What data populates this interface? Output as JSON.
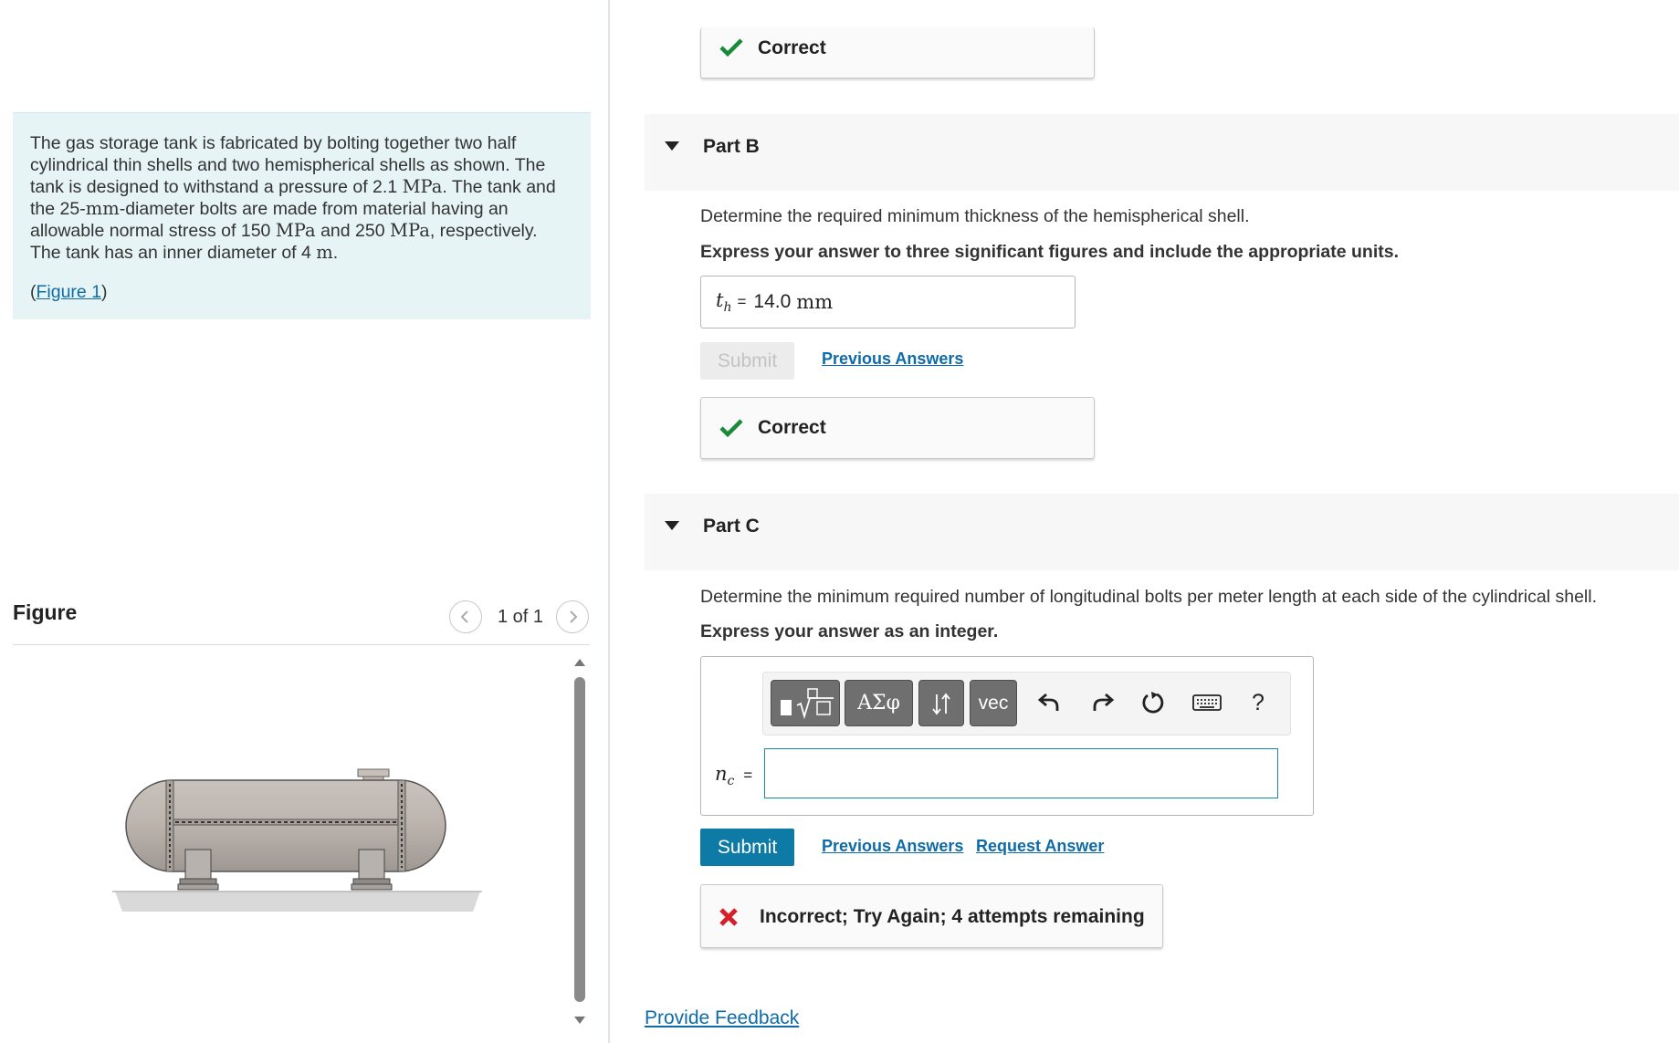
{
  "problem": {
    "line1": "The gas storage tank is fabricated by bolting together two half",
    "line2": "cylindrical thin shells and two hemispherical shells as shown. The",
    "line3_pre": "tank is designed to withstand a pressure of 2.1 ",
    "line3_unit": "MPa",
    "line3_post": ". The tank and",
    "line4_pre": "the 25-",
    "line4_unit": "mm",
    "line4_post": "-diameter bolts are made from material having an",
    "line5_pre": "allowable normal stress of 150 ",
    "line5_unit1": "MPa",
    "line5_mid": " and 250 ",
    "line5_unit2": "MPa",
    "line5_post": ", respectively.",
    "line6_pre": "The tank has an inner diameter of 4 ",
    "line6_unit": "m",
    "line6_post": ".",
    "figure_link": "Figure 1"
  },
  "figure": {
    "title": "Figure",
    "counter": "1 of 1",
    "prev_icon": "chevron-left-icon",
    "next_icon": "chevron-right-icon"
  },
  "part_a": {
    "feedback": "Correct"
  },
  "part_b": {
    "label": "Part B",
    "question": "Determine the required minimum thickness of the hemispherical shell.",
    "instruction": "Express your answer to three significant figures and include the appropriate units.",
    "var_base": "t",
    "var_sub": "h",
    "equals": "=",
    "answer_value": "14.0",
    "answer_unit": "mm",
    "submit_label": "Submit",
    "previous_answers": "Previous Answers",
    "feedback": "Correct"
  },
  "part_c": {
    "label": "Part C",
    "question": "Determine the minimum required number of longitudinal bolts per meter length at each side of the cylindrical shell.",
    "instruction": "Express your answer as an integer.",
    "var_base": "n",
    "var_sub": "c",
    "equals": "=",
    "input_value": "",
    "toolbar": {
      "greek_label": "ΑΣφ",
      "vec_label": "vec",
      "help_label": "?"
    },
    "submit_label": "Submit",
    "previous_answers": "Previous Answers",
    "request_answer": "Request Answer",
    "feedback": "Incorrect; Try Again; 4 attempts remaining"
  },
  "footer": {
    "provide_feedback": "Provide Feedback"
  },
  "colors": {
    "link": "#0e6ba8",
    "submit": "#0d7ba6",
    "correct": "#1a8a3a",
    "incorrect": "#d71f2a",
    "problem_bg": "#e6f4f5"
  }
}
